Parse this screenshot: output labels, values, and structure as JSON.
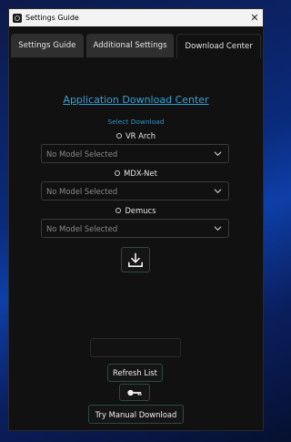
{
  "window": {
    "title": "Settings Guide",
    "close_glyph": "✕"
  },
  "tabs": [
    {
      "label": "Settings Guide",
      "active": false
    },
    {
      "label": "Additional Settings",
      "active": false
    },
    {
      "label": "Download Center",
      "active": true
    }
  ],
  "download_center": {
    "heading": "Application Download Center",
    "subheading": "Select Download",
    "sections": [
      {
        "label": "VR Arch",
        "dropdown_value": "No Model Selected"
      },
      {
        "label": "MDX-Net",
        "dropdown_value": "No Model Selected"
      },
      {
        "label": "Demucs",
        "dropdown_value": "No Model Selected"
      }
    ],
    "download_icon": "download-icon",
    "refresh_label": "Refresh List",
    "key_icon": "key-icon",
    "manual_download_label": "Try Manual Download"
  },
  "colors": {
    "accent": "#33a5d6",
    "panel_bg": "#111111",
    "button_border": "#2a4a40"
  }
}
